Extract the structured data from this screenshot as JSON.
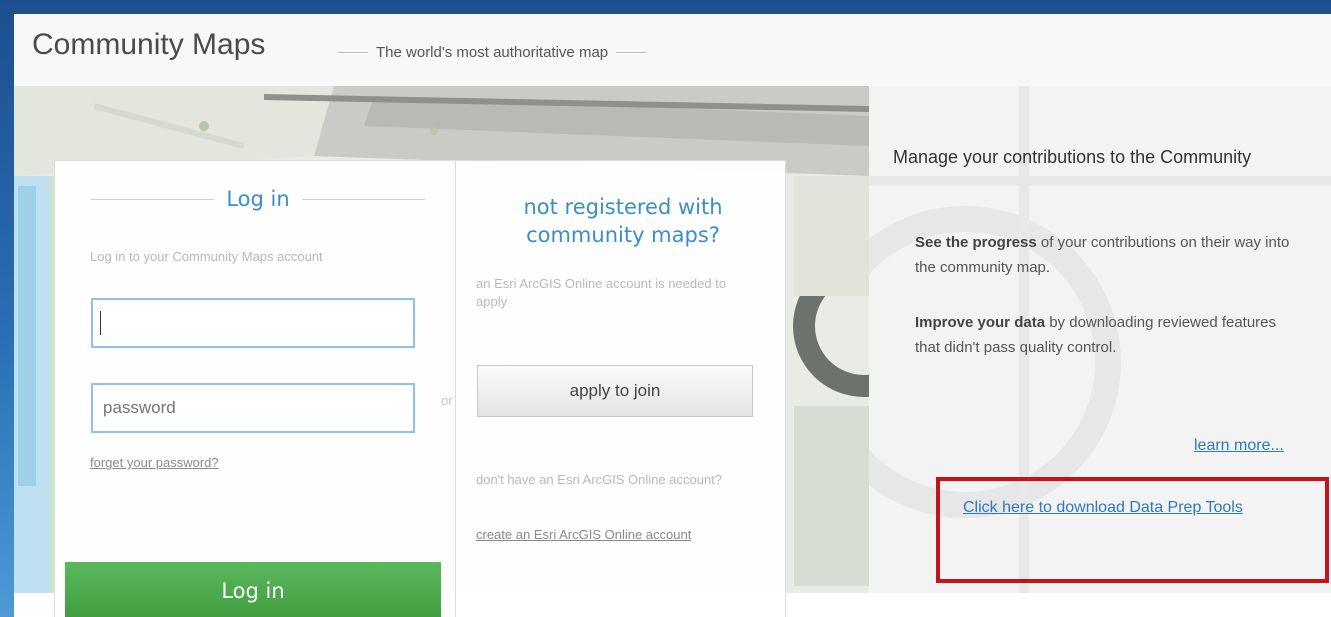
{
  "header": {
    "title": "Community Maps",
    "tagline": "The world's most authoritative map"
  },
  "login": {
    "heading": "Log in",
    "subtitle": "Log in to your Community Maps account",
    "username_value": "",
    "password_placeholder": "password",
    "forget_link": "forget your password?",
    "button_label": "Log in",
    "or_label": "or"
  },
  "register": {
    "heading": "not registered with community maps?",
    "subtitle": "an Esri ArcGIS Online account is needed to apply",
    "apply_button": "apply to join",
    "dont_have": "don't have an Esri ArcGIS Online account?",
    "create_link": "create an Esri ArcGIS Online account"
  },
  "info": {
    "manage": "Manage your contributions to the Community",
    "p1_bold": "See the progress",
    "p1_rest": " of your contributions on their way into the community map.",
    "p2_bold": "Improve your data",
    "p2_rest": " by downloading reviewed features that didn't pass quality control.",
    "learn_more": "learn more...",
    "download_link": "Click here to download Data Prep Tools"
  },
  "colors": {
    "accent_blue": "#3a8fc4",
    "login_green": "#4cae4c",
    "highlight_red": "#c6131a",
    "link_blue": "#2a79c2"
  }
}
